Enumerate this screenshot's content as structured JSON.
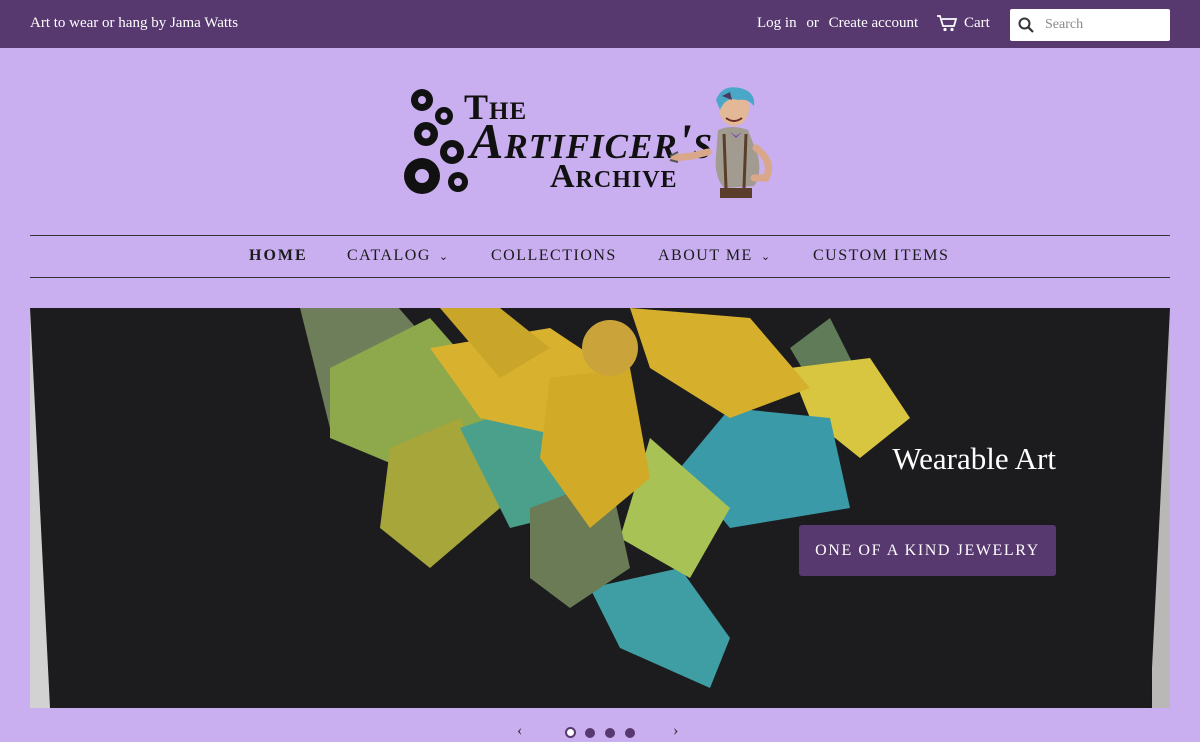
{
  "topbar": {
    "tagline": "Art to wear or hang by Jama Watts",
    "login": "Log in",
    "or": "or",
    "create_account": "Create account",
    "cart": "Cart",
    "search_placeholder": "Search"
  },
  "logo": {
    "line1": "The",
    "line2": "Artificer's",
    "line3": "Archive"
  },
  "nav": {
    "items": [
      {
        "label": "HOME",
        "active": true
      },
      {
        "label": "CATALOG",
        "dropdown": true
      },
      {
        "label": "COLLECTIONS"
      },
      {
        "label": "ABOUT ME",
        "dropdown": true
      },
      {
        "label": "CUSTOM ITEMS"
      }
    ]
  },
  "hero": {
    "heading": "Wearable Art",
    "cta": "ONE OF A KIND JEWELRY"
  },
  "slideshow": {
    "slide_count": 4,
    "active_slide": 1
  },
  "colors": {
    "page_bg": "#c9aef0",
    "brand": "#57386f"
  }
}
